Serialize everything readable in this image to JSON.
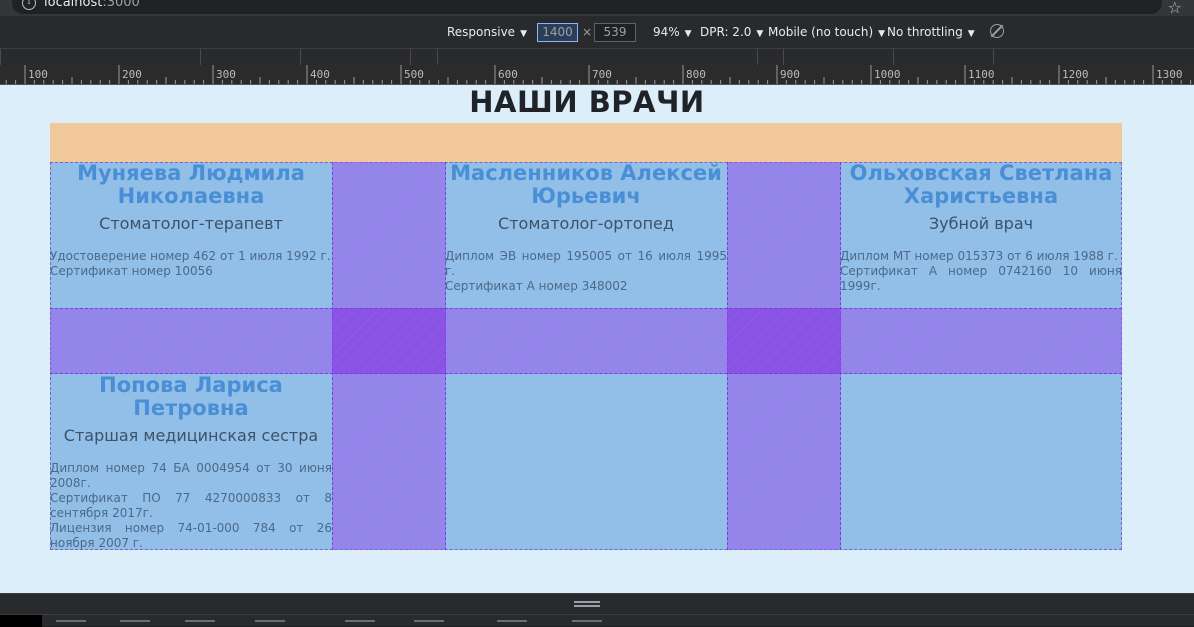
{
  "browser": {
    "url_host": "localhost",
    "url_port": ":3000"
  },
  "device_toolbar": {
    "mode": "Responsive",
    "width": "1400",
    "times": "×",
    "height": "539",
    "zoom": "94%",
    "dpr": "DPR: 2.0",
    "device_type": "Mobile (no touch)",
    "throttling": "No throttling"
  },
  "ruler": [
    "100",
    "200",
    "300",
    "400",
    "500",
    "600",
    "700",
    "800",
    "900",
    "1000",
    "1100",
    "1200",
    "1300"
  ],
  "page": {
    "title": "НАШИ ВРАЧИ",
    "doctors": [
      {
        "name": "Муняева Людмила Николаевна",
        "role": "Стоматолог-терапевт",
        "docs": [
          "Удостоверение номер 462 от 1 июля 1992 г.",
          "Сертификат номер 10056"
        ]
      },
      {
        "name": "Масленников Алексей Юрьевич",
        "role": "Стоматолог-ортопед",
        "docs": [
          "Диплом ЭВ номер 195005 от 16 июля 1995 г.",
          "Сертификат А номер 348002"
        ]
      },
      {
        "name": "Ольховская Светлана Харистьевна",
        "role": "Зубной врач",
        "docs": [
          "Диплом МТ номер 015373 от 6 июля 1988 г.",
          "Сертификат А номер 0742160 10 июня 1999г."
        ]
      },
      {
        "name": "Попова Лариса Петровна",
        "role": "Старшая медицинская сестра",
        "docs": [
          "Диплом номер 74 БА 0004954 от 30 июня 2008г.",
          "Сертификат ПО 77 4270000833 от 8 сентября 2017г.",
          "Лицензия номер 74-01-000 784 от 26 ноября 2007 г."
        ]
      }
    ]
  }
}
